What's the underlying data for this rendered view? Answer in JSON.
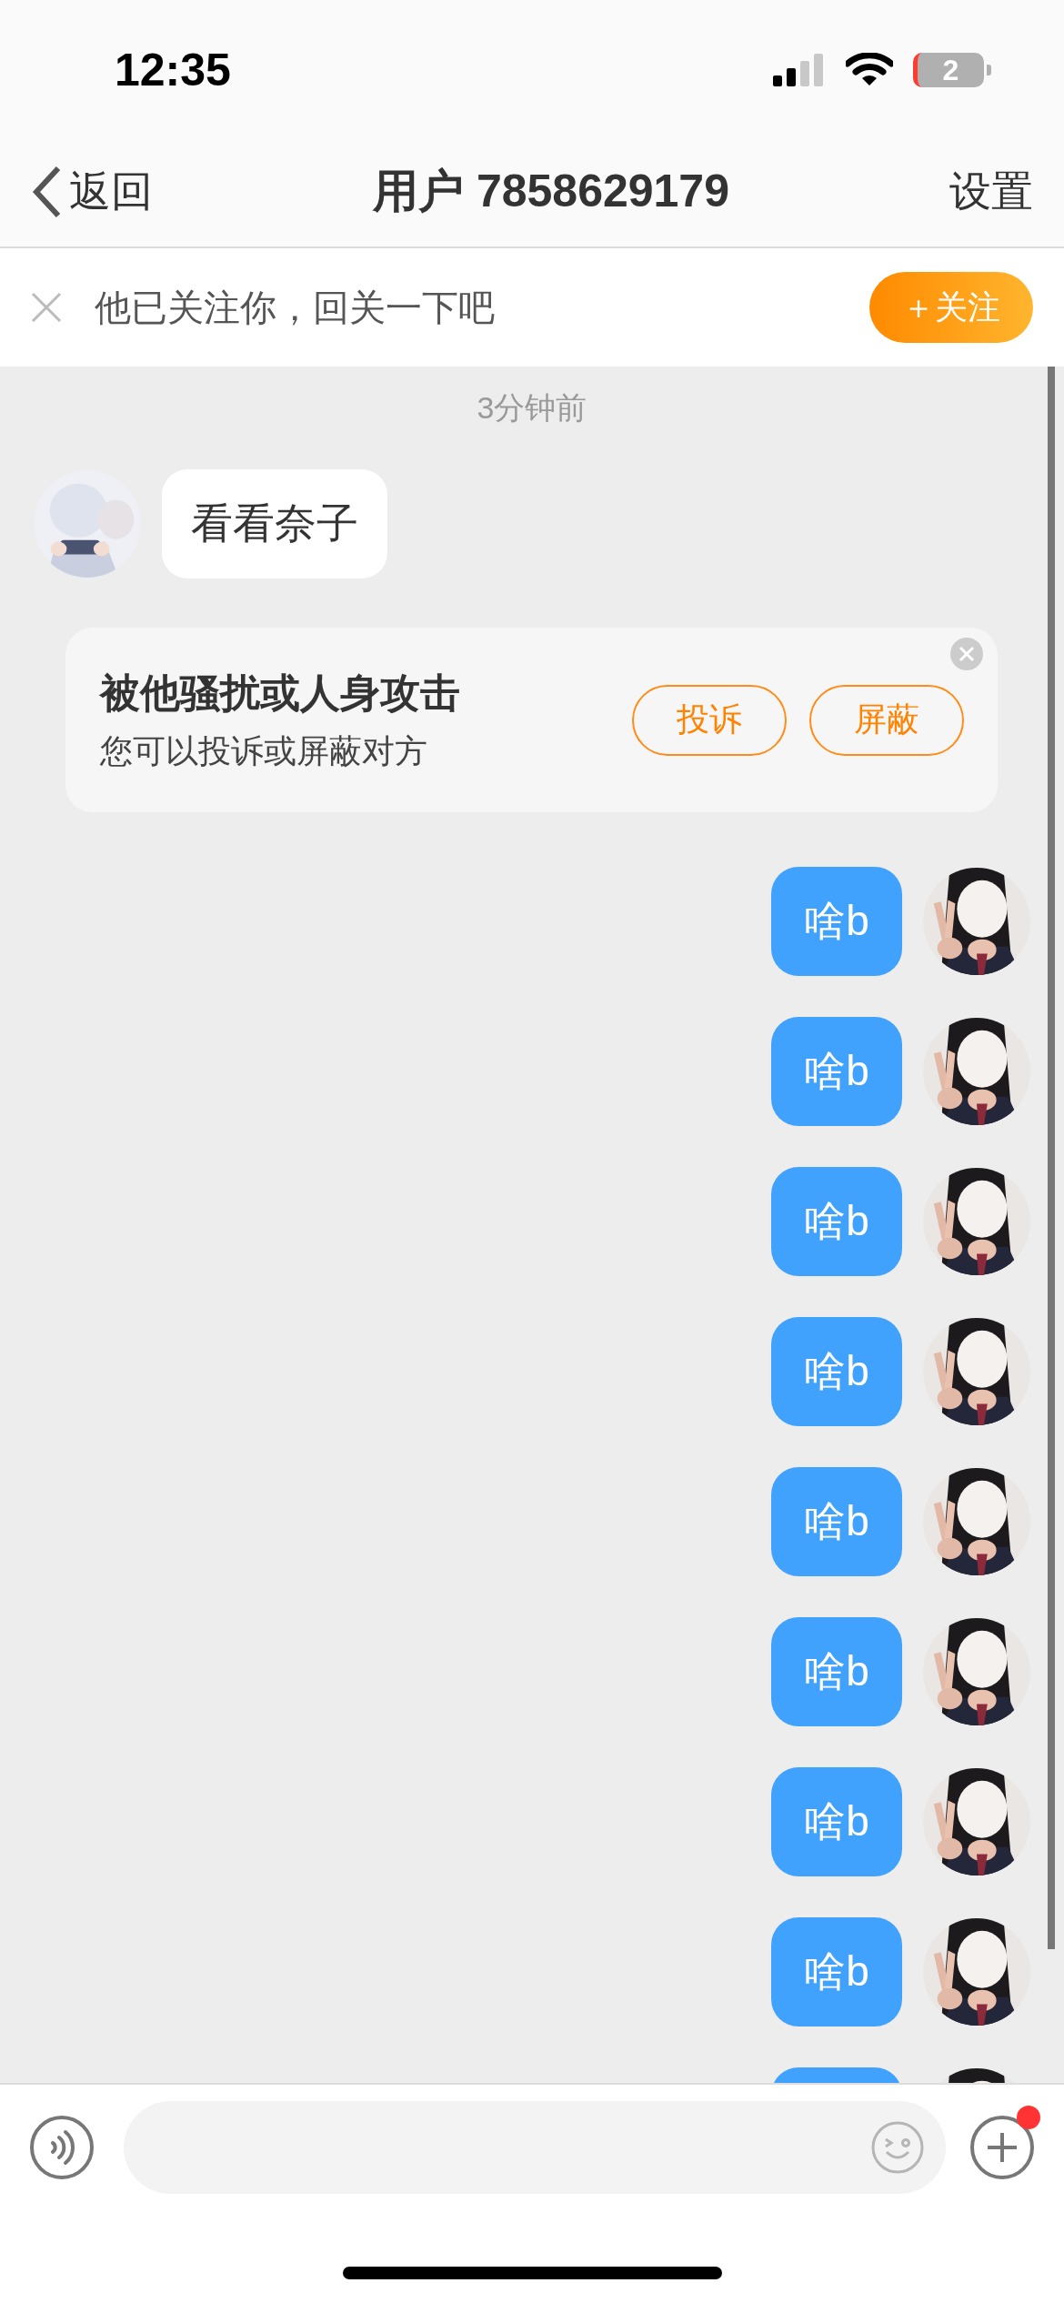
{
  "status_bar": {
    "time": "12:35",
    "battery": "2",
    "battery_low": true
  },
  "nav": {
    "back": "返回",
    "title": "用户 7858629179",
    "settings": "设置"
  },
  "follow_banner": {
    "text": "他已关注你，回关一下吧",
    "button": "＋关注"
  },
  "chat": {
    "timestamp": "3分钟前",
    "messages": [
      {
        "kind": "incoming",
        "text": "看看奈子"
      },
      {
        "kind": "notice",
        "title": "被他骚扰或人身攻击",
        "subtitle": "您可以投诉或屏蔽对方",
        "buttons": [
          "投诉",
          "屏蔽"
        ]
      },
      {
        "kind": "outgoing",
        "text": "啥b"
      },
      {
        "kind": "outgoing",
        "text": "啥b"
      },
      {
        "kind": "outgoing",
        "text": "啥b"
      },
      {
        "kind": "outgoing",
        "text": "啥b"
      },
      {
        "kind": "outgoing",
        "text": "啥b"
      },
      {
        "kind": "outgoing",
        "text": "啥b"
      },
      {
        "kind": "outgoing",
        "text": "啥b"
      },
      {
        "kind": "outgoing",
        "text": "啥b"
      }
    ],
    "more_below": true
  },
  "composer": {
    "plus_badge": true
  }
}
